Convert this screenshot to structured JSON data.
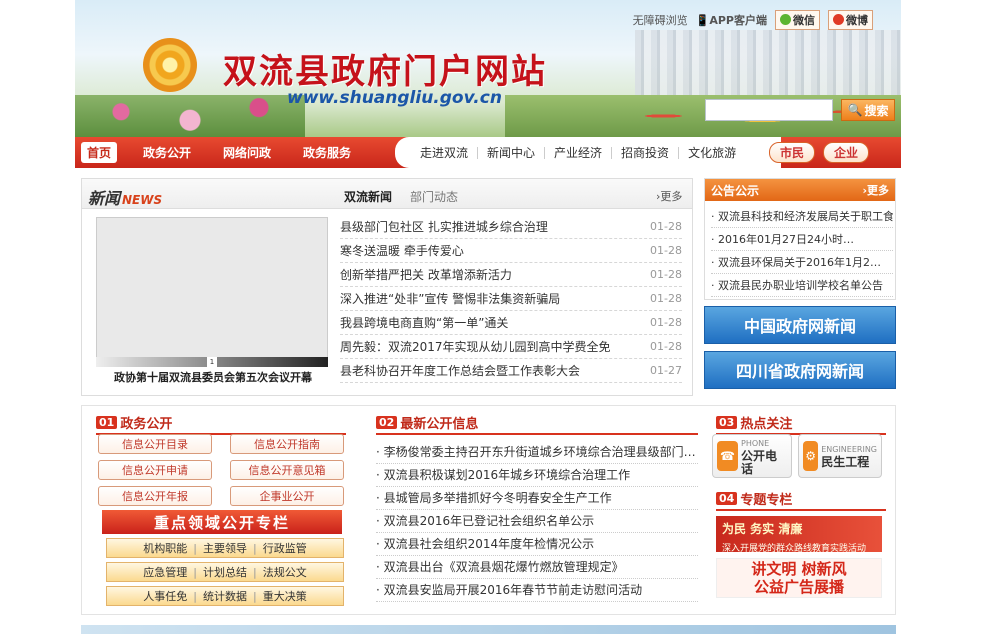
{
  "header": {
    "accessibility": "无障碍浏览",
    "app_client": "APP客户端",
    "wechat": "微信",
    "weibo": "微博",
    "title": "双流县政府门户网站",
    "url": "www.shuangliu.gov.cn",
    "search_placeholder": "",
    "search_button": "搜索"
  },
  "nav": {
    "left": [
      "首页",
      "政务公开",
      "网络问政",
      "政务服务"
    ],
    "middle": [
      "走进双流",
      "新闻中心",
      "产业经济",
      "招商投资",
      "文化旅游"
    ],
    "right": [
      "市民",
      "企业"
    ]
  },
  "news": {
    "title": "新闻",
    "title_en": "NEWS",
    "tabs": [
      "双流新闻",
      "部门动态"
    ],
    "more": "更多",
    "photo_index": "1",
    "photo_caption": "政协第十届双流县委员会第五次会议开幕",
    "items": [
      {
        "title": "县级部门包社区 扎实推进城乡综合治理",
        "date": "01-28"
      },
      {
        "title": "寒冬送温暖 牵手传爱心",
        "date": "01-28"
      },
      {
        "title": "创新举措严把关 改革增添新活力",
        "date": "01-28"
      },
      {
        "title": "深入推进“处非”宣传 警惕非法集资新骗局",
        "date": "01-28"
      },
      {
        "title": "我县跨境电商直购“第一单”通关",
        "date": "01-28"
      },
      {
        "title": "周先毅：双流2017年实现从幼儿园到高中学费全免",
        "date": "01-28"
      },
      {
        "title": "县老科协召开年度工作总结会暨工作表彰大会",
        "date": "01-27"
      }
    ]
  },
  "notice": {
    "title": "公告公示",
    "more": "更多",
    "items": [
      "双流县科技和经济发展局关于职工食…",
      "2016年01月27日24小时…",
      "双流县环保局关于2016年1月2…",
      "双流县民办职业培训学校名单公告"
    ],
    "links": [
      "中国政府网新闻",
      "四川省政府网新闻"
    ]
  },
  "gov_open": {
    "num": "01",
    "title": "政务公开",
    "buttons": [
      "信息公开目录",
      "信息公开指南",
      "信息公开申请",
      "信息公开意见箱",
      "信息公开年报",
      "企事业公开"
    ],
    "banner": "重点领域公开专栏",
    "rows": [
      [
        "机构职能",
        "主要领导",
        "行政监管"
      ],
      [
        "应急管理",
        "计划总结",
        "法规公文"
      ],
      [
        "人事任免",
        "统计数据",
        "重大决策"
      ]
    ]
  },
  "latest": {
    "num": "02",
    "title": "最新公开信息",
    "items": [
      "李杨俊常委主持召开东升街道城乡环境综合治理县级部门…",
      "双流县积极谋划2016年城乡环境综合治理工作",
      "县城管局多举措抓好今冬明春安全生产工作",
      "双流县2016年已登记社会组织名单公示",
      "双流县社会组织2014年度年检情况公示",
      "双流县出台《双流县烟花爆竹燃放管理规定》",
      "双流县安监局开展2016年春节节前走访慰问活动"
    ]
  },
  "hot": {
    "num": "03",
    "title": "热点关注",
    "items": [
      {
        "en": "PHONE",
        "cn": "公开电话"
      },
      {
        "en": "ENGINEERING",
        "cn": "民生工程"
      }
    ]
  },
  "topics": {
    "num": "04",
    "title": "专题专栏",
    "a_line1": "为民 务实 清廉",
    "a_line2": "深入开展党的群众路线教育实践活动",
    "b_line1": "讲文明 树新风",
    "b_line2": "公益广告展播"
  }
}
